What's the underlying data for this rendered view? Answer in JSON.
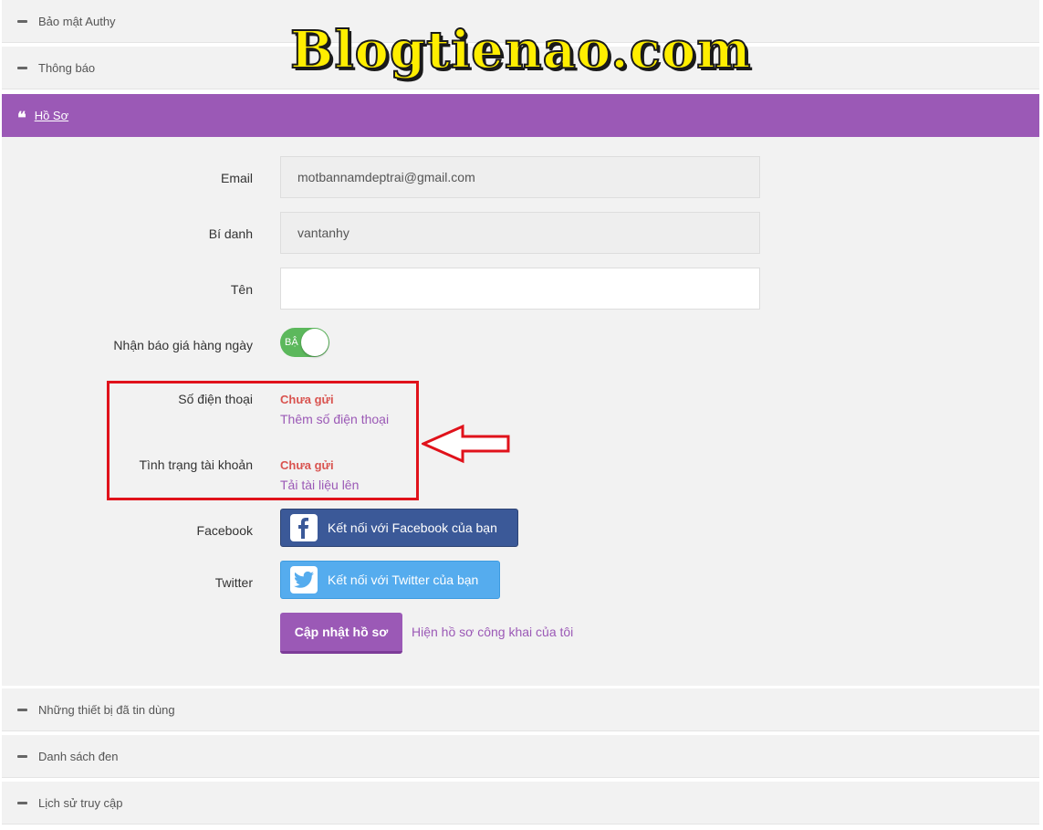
{
  "watermark": "Blogtienao.com",
  "sections": {
    "authy": "Bảo mật Authy",
    "notifications": "Thông báo",
    "profile": "Hồ Sơ",
    "trusted_devices": "Những thiết bị đã tin dùng",
    "blacklist": "Danh sách đen",
    "access_history": "Lịch sử truy cập"
  },
  "form": {
    "email_label": "Email",
    "email_value": "motbannamdeptrai@gmail.com",
    "alias_label": "Bí danh",
    "alias_value": "vantanhy",
    "name_label": "Tên",
    "name_value": "",
    "daily_price_label": "Nhận báo giá hàng ngày",
    "toggle_text": "BẬ",
    "phone_label": "Số điện thoại",
    "phone_status": "Chưa gửi",
    "phone_link": "Thêm số điện thoại",
    "account_label": "Tình trạng tài khoản",
    "account_status": "Chưa gửi",
    "account_link": "Tải tài liệu lên",
    "facebook_label": "Facebook",
    "facebook_button": "Kết nối với Facebook của bạn",
    "twitter_label": "Twitter",
    "twitter_button": "Kết nối với Twitter của bạn",
    "update_button": "Cập nhật hồ sơ",
    "public_profile_link": "Hiện hồ sơ công khai của tôi"
  },
  "colors": {
    "accent": "#9b59b6",
    "status_red": "#d9534f",
    "toggle_on": "#5cb85c",
    "facebook": "#3b5998",
    "twitter": "#55acee",
    "annotation": "#e0121b"
  },
  "toggle_state": "on"
}
